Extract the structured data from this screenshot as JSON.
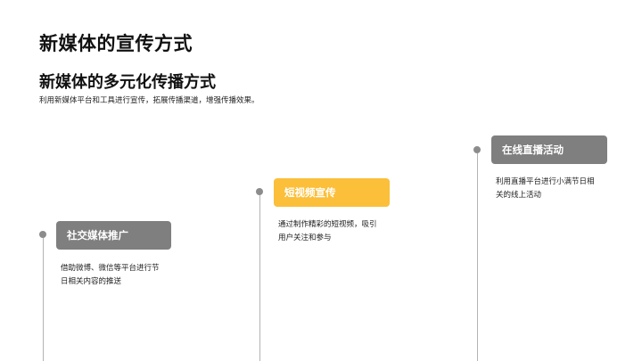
{
  "slide": {
    "title": "新媒体的宣传方式"
  },
  "section": {
    "title": "新媒体的多元化传播方式",
    "description": "利用新媒体平台和工具进行宣传，拓展传播渠道，增强传播效果。"
  },
  "colors": {
    "accent": "#fbbf3a",
    "label_grey": "#7f7f7f",
    "line_grey": "#b3b3b3",
    "dot_grey": "#8c8c8c"
  },
  "timeline": [
    {
      "label": "社交媒体推广",
      "text_line1": "借助微博、微信等平台进行节",
      "text_line2": "日相关内容的推送",
      "highlight": false
    },
    {
      "label": "短视频宣传",
      "text_line1": "通过制作精彩的短视频，吸引",
      "text_line2": "用户关注和参与",
      "highlight": true
    },
    {
      "label": "在线直播活动",
      "text_line1": "利用直播平台进行小满节日相",
      "text_line2": "关的线上活动",
      "highlight": false
    }
  ]
}
